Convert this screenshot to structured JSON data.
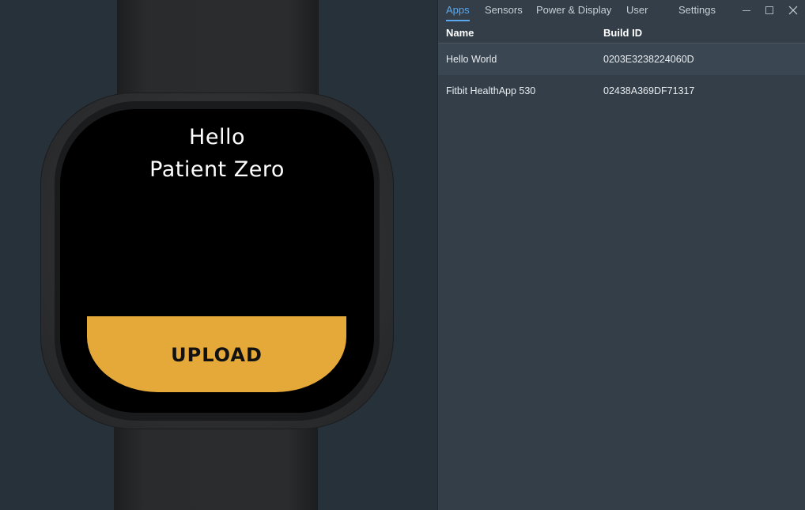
{
  "simulator": {
    "greeting_line1": "Hello",
    "greeting_line2": "Patient Zero",
    "upload_label": "UPLOAD",
    "accent_color": "#e5a93a"
  },
  "panel": {
    "tabs": [
      {
        "label": "Apps",
        "active": true
      },
      {
        "label": "Sensors",
        "active": false
      },
      {
        "label": "Power & Display",
        "active": false
      },
      {
        "label": "User",
        "active": false
      },
      {
        "label": "Settings",
        "active": false
      }
    ],
    "window_controls": [
      "minimize-icon",
      "maximize-icon",
      "close-icon"
    ],
    "columns": [
      "Name",
      "Build ID"
    ],
    "rows": [
      {
        "name": "Hello World",
        "build_id": "0203E3238224060D",
        "selected": true
      },
      {
        "name": "Fitbit HealthApp 530",
        "build_id": "02438A369DF71317",
        "selected": false
      }
    ],
    "accent_color": "#5aa9f0"
  }
}
